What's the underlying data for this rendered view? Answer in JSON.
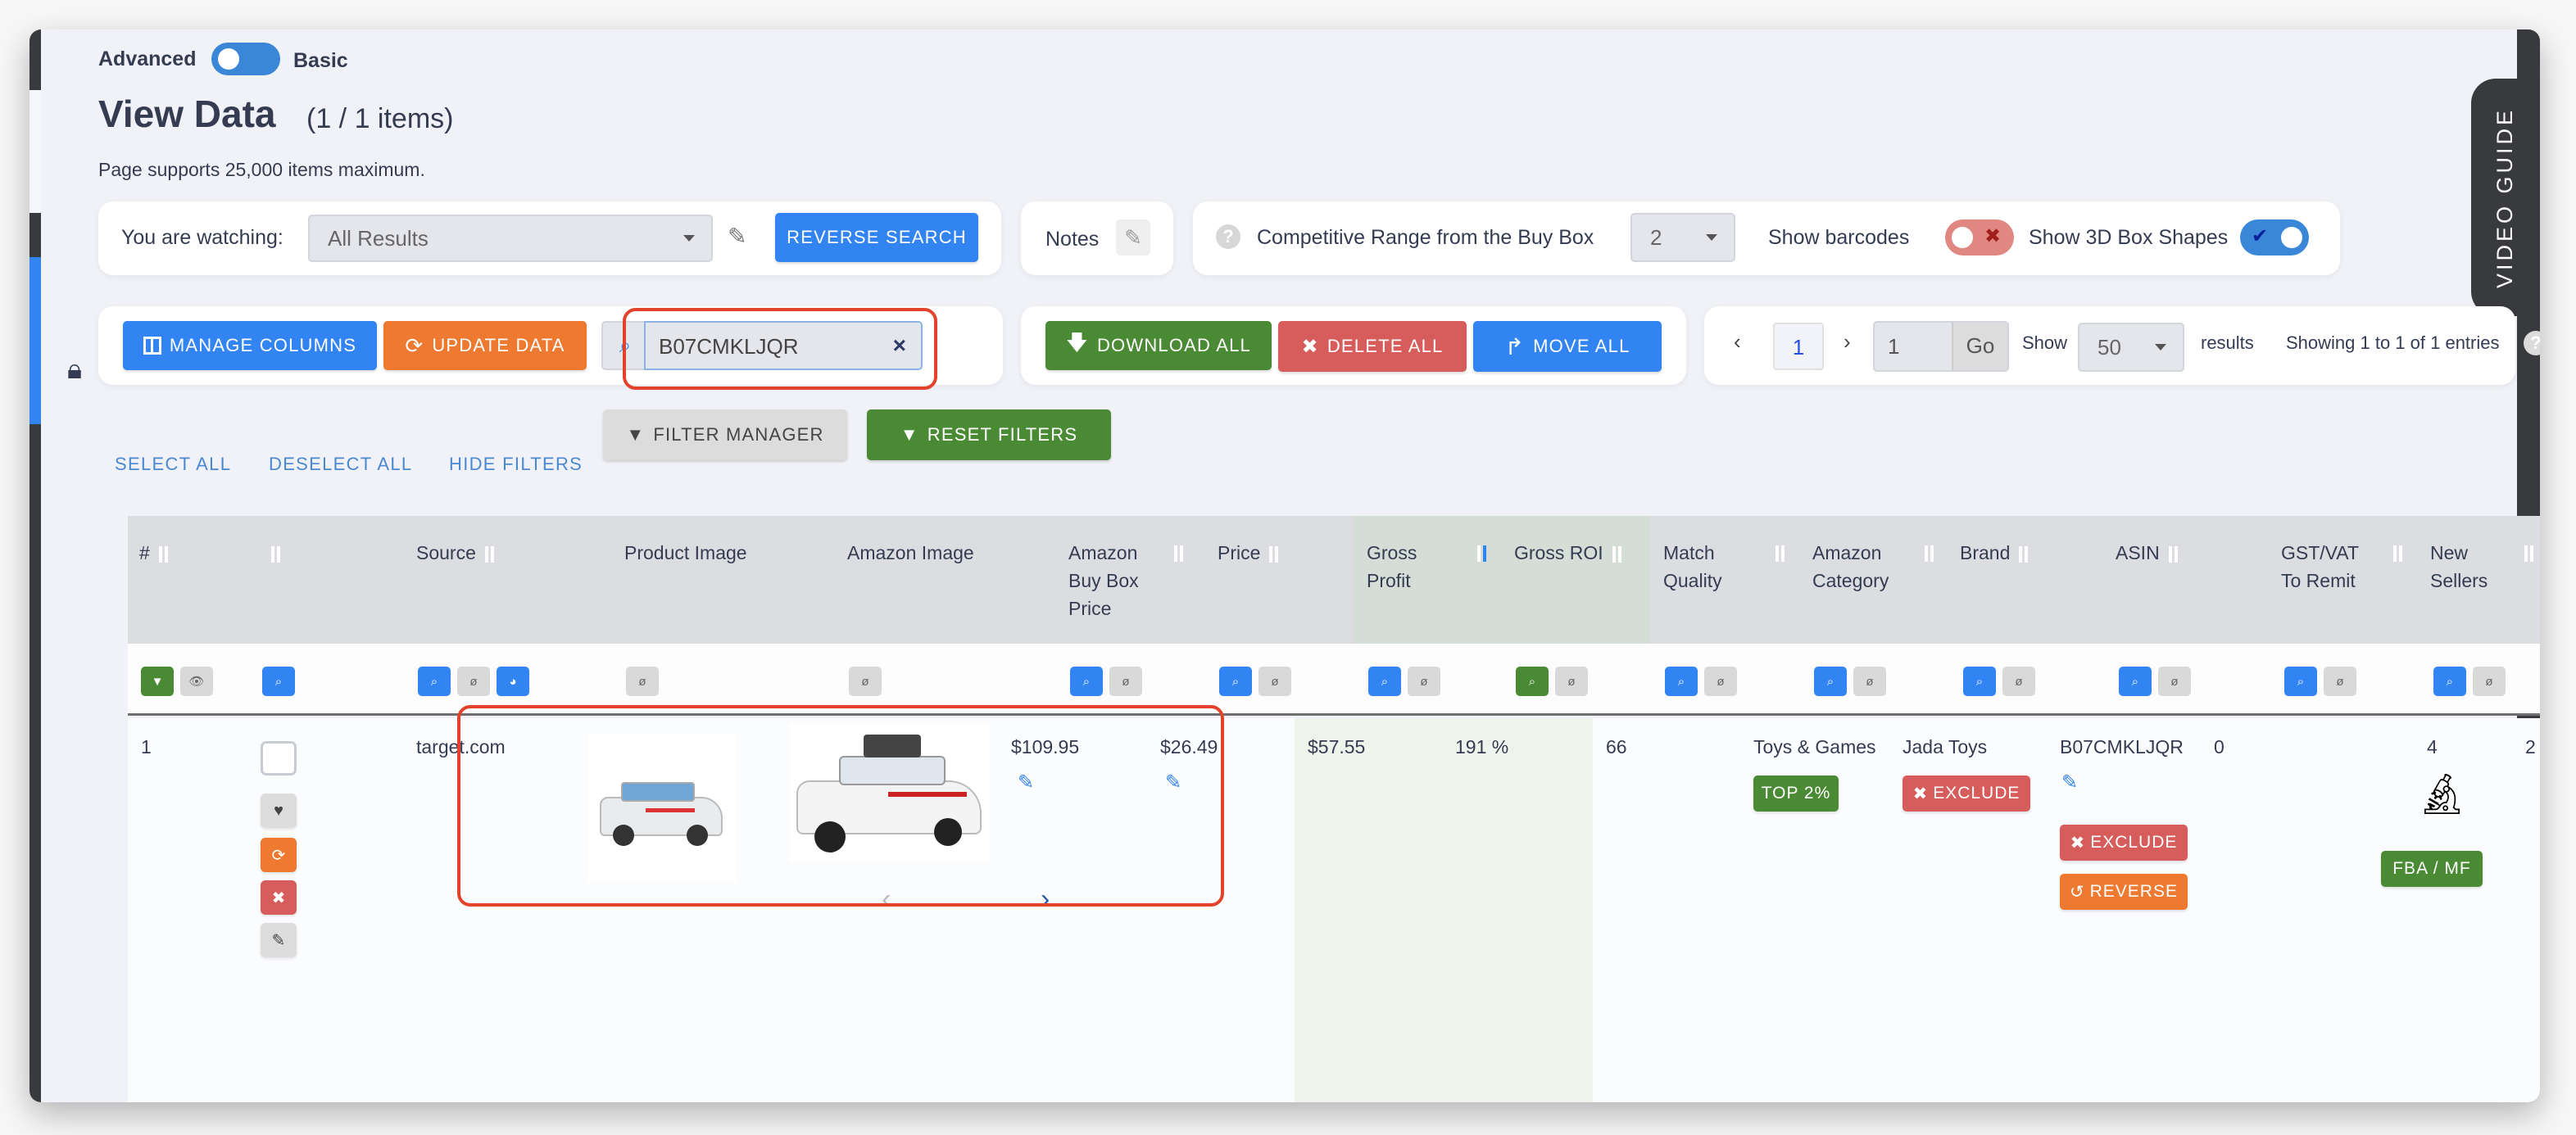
{
  "mode_toggle": {
    "left_label": "Advanced",
    "right_label": "Basic",
    "state": "basic"
  },
  "page": {
    "title": "View Data",
    "count": "(1 / 1 items)",
    "note": "Page supports 25,000 items maximum."
  },
  "watch_panel": {
    "label": "You are watching:",
    "select_value": "All Results",
    "reverse_search": "REVERSE SEARCH"
  },
  "notes_panel": {
    "label": "Notes"
  },
  "settings_panel": {
    "competitive_label": "Competitive Range from the Buy Box",
    "competitive_value": "2",
    "show_barcodes_label": "Show barcodes",
    "show_barcodes_on": false,
    "show_3d_label": "Show 3D Box Shapes",
    "show_3d_on": true
  },
  "toolbar": {
    "manage_columns": "MANAGE COLUMNS",
    "update_data": "UPDATE DATA",
    "search_value": "B07CMKLJQR",
    "download_all": "DOWNLOAD ALL",
    "delete_all": "DELETE ALL",
    "move_all": "MOVE ALL"
  },
  "pagination": {
    "current_page": "1",
    "goto_value": "1",
    "go_label": "Go",
    "show_label": "Show",
    "page_size": "50",
    "results_label": "results",
    "summary": "Showing 1 to 1 of 1 entries"
  },
  "video_guide": "VIDEO GUIDE",
  "actions": {
    "select_all": "SELECT ALL",
    "deselect_all": "DESELECT ALL",
    "hide_filters": "HIDE FILTERS",
    "filter_manager": "FILTER MANAGER",
    "reset_filters": "RESET FILTERS"
  },
  "table": {
    "columns": [
      {
        "label": "#"
      },
      {
        "label": ""
      },
      {
        "label": "Source"
      },
      {
        "label": "Product Image"
      },
      {
        "label": "Amazon Image"
      },
      {
        "label": "Amazon Buy Box Price"
      },
      {
        "label": "Price"
      },
      {
        "label": "Gross Profit",
        "sorted": "desc"
      },
      {
        "label": "Gross ROI"
      },
      {
        "label": "Match Quality"
      },
      {
        "label": "Amazon Category"
      },
      {
        "label": "Brand"
      },
      {
        "label": "ASIN"
      },
      {
        "label": "GST/VAT To Remit"
      },
      {
        "label": "New Sellers"
      }
    ],
    "row": {
      "index": "1",
      "source": "target.com",
      "buy_box_price": "$109.95",
      "price": "$26.49",
      "gross_profit": "$57.55",
      "gross_roi": "191 %",
      "match_quality": "66",
      "category": "Toys & Games",
      "category_badge": "TOP 2%",
      "brand": "Jada Toys",
      "brand_badge": "EXCLUDE",
      "asin": "B07CMKLJQR",
      "asin_exclude": "EXCLUDE",
      "asin_reverse": "REVERSE",
      "gst_vat": "0",
      "new_sellers": "4",
      "fulfillment_badge": "FBA / MF",
      "next_col": "2"
    }
  },
  "colors": {
    "primary_blue": "#3284f2",
    "orange": "#ed7a30",
    "green": "#4a8a34",
    "red": "#d65d5b",
    "highlight_red": "#e2432a"
  }
}
